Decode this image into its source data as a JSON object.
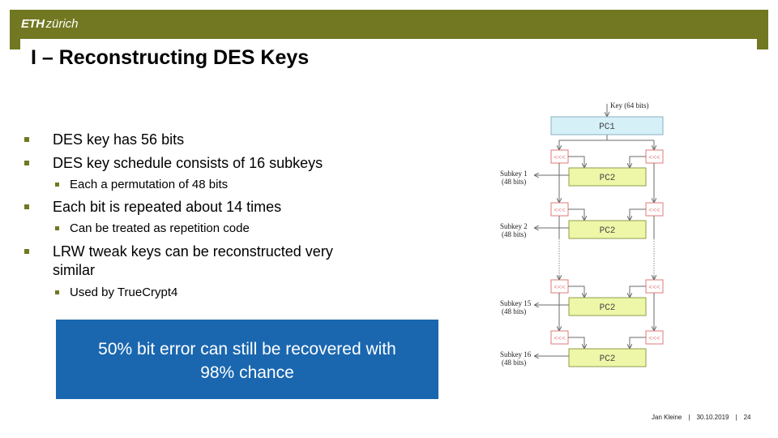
{
  "header": {
    "logo_eth": "ETH",
    "logo_zurich": "zürich",
    "brand_color": "#717821"
  },
  "slide": {
    "title": "I – Reconstructing DES Keys",
    "bullets": [
      {
        "level": 1,
        "text": "DES key has 56 bits"
      },
      {
        "level": 1,
        "text": "DES key schedule consists of 16 subkeys"
      },
      {
        "level": 2,
        "text": "Each a permutation of 48 bits"
      },
      {
        "level": 1,
        "text": "Each bit is repeated about 14 times"
      },
      {
        "level": 2,
        "text": "Can be treated as repetition code"
      },
      {
        "level": 1,
        "text": "LRW tweak keys can be reconstructed very"
      },
      {
        "level": 1,
        "text": "similar",
        "continuation": true
      },
      {
        "level": 2,
        "text": "Used by TrueCrypt4"
      }
    ],
    "callout": {
      "line1": "50% bit error can still be recovered with",
      "line2": "98% chance",
      "background": "#1a67b0"
    }
  },
  "diagram": {
    "key_label": "Key (64 bits)",
    "pc1_label": "PC1",
    "pc2_label": "PC2",
    "rotate_label": "<<<",
    "rounds": [
      {
        "subkey": "Subkey 1",
        "bits": "(48 bits)"
      },
      {
        "subkey": "Subkey 2",
        "bits": "(48 bits)"
      },
      {
        "subkey": "Subkey 15",
        "bits": "(48 bits)"
      },
      {
        "subkey": "Subkey 16",
        "bits": "(48 bits)"
      }
    ],
    "colors": {
      "pc1_fill": "#d6f0f7",
      "pc2_fill": "#eef7a8",
      "rotate_stroke": "#e07878",
      "line": "#6b6b6b"
    }
  },
  "footer": {
    "author": "Jan Kleine",
    "date": "30.10.2019",
    "page": "24",
    "separator": "|"
  }
}
